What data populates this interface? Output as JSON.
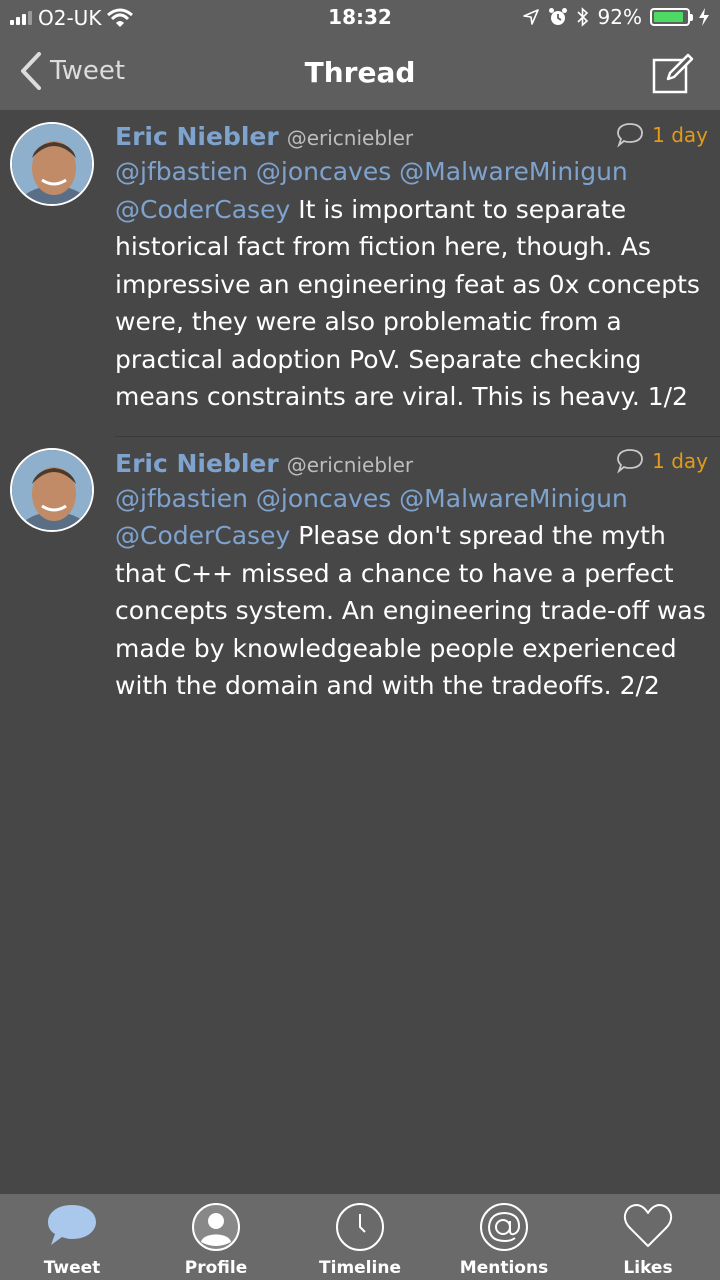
{
  "status_bar": {
    "carrier": "O2-UK",
    "time": "18:32",
    "battery": "92%",
    "battery_level": 0.92,
    "battery_color": "#4cd964"
  },
  "nav": {
    "back_label": "Tweet",
    "title": "Thread",
    "compose_icon": "compose-icon"
  },
  "tweets": [
    {
      "author": "Eric Niebler",
      "handle": "@ericniebler",
      "age": "1 day",
      "mentions_line": "@jfbastien @joncaves @MalwareMinigun",
      "mention_inline": "@CoderCasey",
      "text": " It is important to separate historical fact from fiction here, though. As impressive an engineering feat as 0x concepts were, they were also problematic from a practical adoption PoV. Separate checking means constraints are viral. This is heavy. 1/2"
    },
    {
      "author": "Eric Niebler",
      "handle": "@ericniebler",
      "age": "1 day",
      "mentions_line": "@jfbastien @joncaves @MalwareMinigun",
      "mention_inline": "@CoderCasey",
      "text": " Please don't spread the myth that C++ missed a chance to have a perfect concepts system. An engineering trade-off was made by knowledgeable people experienced with the domain and with the tradeoffs. 2/2"
    }
  ],
  "tabs": [
    {
      "label": "Tweet",
      "icon": "speech-bubble-icon",
      "active": true
    },
    {
      "label": "Profile",
      "icon": "person-icon"
    },
    {
      "label": "Timeline",
      "icon": "clock-icon"
    },
    {
      "label": "Mentions",
      "icon": "at-sign-icon"
    },
    {
      "label": "Likes",
      "icon": "heart-icon"
    }
  ],
  "colors": {
    "background": "#474747",
    "bars": "#5e5e5e",
    "link": "#7fa3cf",
    "age": "#e39b17",
    "active_tab": "#a9c8ec"
  }
}
